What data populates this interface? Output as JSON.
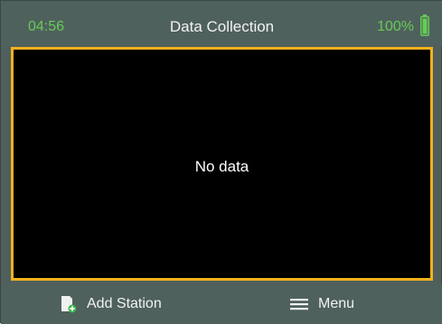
{
  "status_bar": {
    "time": "04:56",
    "title": "Data Collection",
    "battery": "100%"
  },
  "main": {
    "empty_message": "No data"
  },
  "softkeys": {
    "left_label": "Add Station",
    "right_label": "Menu"
  },
  "colors": {
    "accent_green": "#66cc55",
    "highlight_orange": "#f2b11d",
    "bar_background": "#4f615d",
    "screen_background": "#000000"
  },
  "icons": {
    "battery": "battery-full-icon",
    "add_station": "add-document-icon",
    "menu": "hamburger-menu-icon"
  }
}
